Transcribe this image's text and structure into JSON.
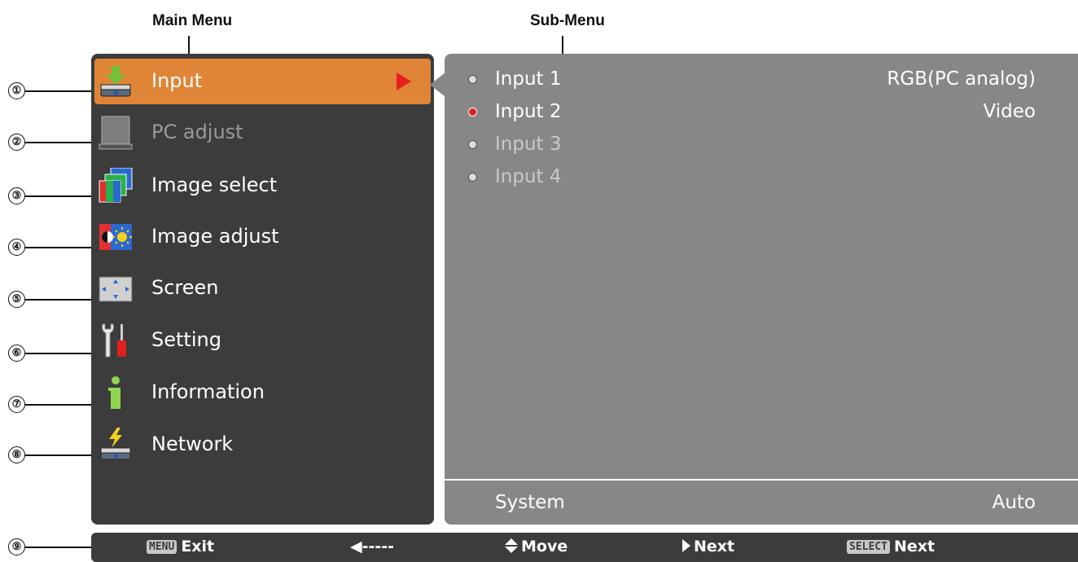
{
  "callouts": {
    "main_menu": "Main Menu",
    "sub_menu": "Sub-Menu",
    "numbers": [
      "①",
      "②",
      "③",
      "④",
      "⑤",
      "⑥",
      "⑦",
      "⑧",
      "⑨"
    ]
  },
  "main_menu": {
    "items": [
      {
        "label": "Input",
        "icon": "input-icon",
        "selected": true
      },
      {
        "label": "PC adjust",
        "icon": "pc-adjust-icon",
        "disabled": true
      },
      {
        "label": "Image select",
        "icon": "image-select-icon"
      },
      {
        "label": "Image adjust",
        "icon": "image-adjust-icon"
      },
      {
        "label": "Screen",
        "icon": "screen-icon"
      },
      {
        "label": "Setting",
        "icon": "setting-icon"
      },
      {
        "label": "Information",
        "icon": "information-icon"
      },
      {
        "label": "Network",
        "icon": "network-icon"
      }
    ]
  },
  "sub_menu": {
    "rows": [
      {
        "label": "Input 1",
        "value": "RGB(PC analog)"
      },
      {
        "label": "Input 2",
        "value": "Video",
        "active": true
      },
      {
        "label": "Input 3",
        "value": ""
      },
      {
        "label": "Input 4",
        "value": ""
      }
    ],
    "system": {
      "label": "System",
      "value": "Auto"
    }
  },
  "guide_bar": {
    "exit_key": "MENU",
    "exit_label": "Exit",
    "back_label": "◀-----",
    "move_label": "Move",
    "next_label": "Next",
    "select_key": "SELECT",
    "select_next_label": "Next"
  },
  "colors": {
    "panel": "#3c3c3c",
    "selected": "#e08437",
    "submenu_bg": "#878787",
    "arrow": "#e62020"
  }
}
